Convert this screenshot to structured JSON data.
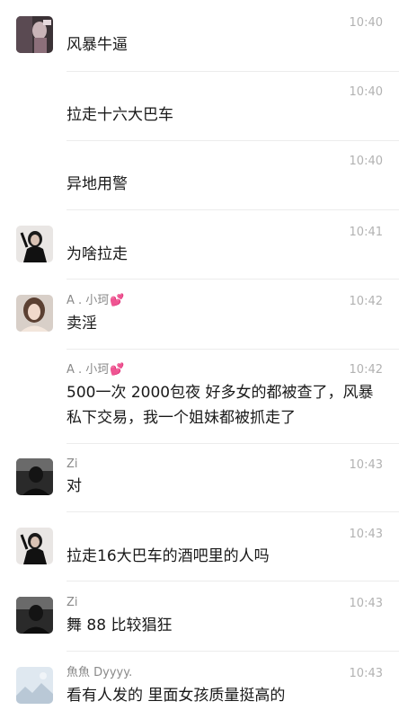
{
  "messages": [
    {
      "sender": "",
      "heart": "",
      "text": "风暴牛逼",
      "time": "10:40",
      "avatar": "photo-dark-icon"
    },
    {
      "sender": "",
      "heart": "",
      "text": "拉走十六大巴车",
      "time": "10:40",
      "avatar": ""
    },
    {
      "sender": "",
      "heart": "",
      "text": "异地用警",
      "time": "10:40",
      "avatar": ""
    },
    {
      "sender": "",
      "heart": "",
      "text": "为啥拉走",
      "time": "10:41",
      "avatar": "woman-black-outfit-icon"
    },
    {
      "sender": "A . 小珂",
      "heart": "💕",
      "text": "卖淫",
      "time": "10:42",
      "avatar": "woman-portrait-icon"
    },
    {
      "sender": "A . 小珂",
      "heart": "💕",
      "text": "500一次 2000包夜 好多女的都被查了，风暴私下交易，我一个姐妹都被抓走了",
      "time": "10:42",
      "avatar": ""
    },
    {
      "sender": "Zi",
      "heart": "",
      "text": "对",
      "time": "10:43",
      "avatar": "dark-silhouette-icon"
    },
    {
      "sender": "",
      "heart": "",
      "text": "拉走16大巴车的酒吧里的人吗",
      "time": "10:43",
      "avatar": "woman-black-outfit-icon"
    },
    {
      "sender": "Zi",
      "heart": "",
      "text": "舞 88 比较猖狂",
      "time": "10:43",
      "avatar": "dark-silhouette-icon"
    },
    {
      "sender": "魚魚 Dyyyy.",
      "heart": "",
      "text": "看有人发的 里面女孩质量挺高的",
      "time": "10:43",
      "avatar": "landscape-icon"
    }
  ],
  "colors": {
    "text": "#191919",
    "sender": "#8a8a8a",
    "time": "#b2b2b2",
    "divider": "#ececec",
    "heart": "#f06292"
  }
}
